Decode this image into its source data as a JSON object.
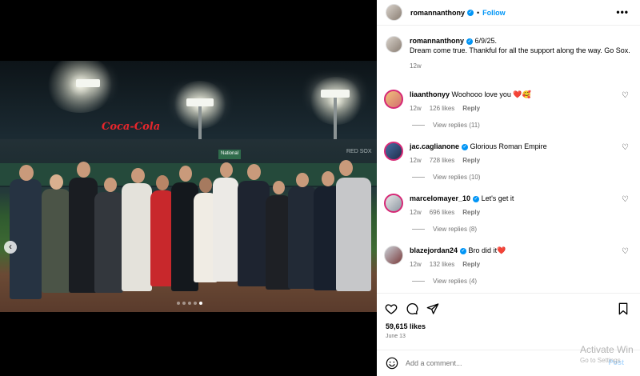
{
  "post": {
    "username": "romannanthony",
    "follow_label": "Follow",
    "more_label": "•••",
    "caption": {
      "username": "romannanthony",
      "date_prefix": "6/9/25.",
      "text": "Dream come true. Thankful for all the support along the way. Go Sox.",
      "time": "12w"
    },
    "likes": "59,615 likes",
    "date": "June 13"
  },
  "comments": [
    {
      "username": "liaanthonyy",
      "text": "Woohooo love you ❤️🥰",
      "verified": false,
      "time": "12w",
      "likes": "126 likes",
      "reply_label": "Reply",
      "view_replies": "View replies (11)"
    },
    {
      "username": "jac.caglianone",
      "text": "Glorious Roman Empire",
      "verified": true,
      "time": "12w",
      "likes": "728 likes",
      "reply_label": "Reply",
      "view_replies": "View replies (10)"
    },
    {
      "username": "marcelomayer_10",
      "text": "Let's get it",
      "verified": true,
      "time": "12w",
      "likes": "696 likes",
      "reply_label": "Reply",
      "view_replies": "View replies (8)"
    },
    {
      "username": "blazejordan24",
      "text": "Bro did it❤️",
      "verified": true,
      "time": "12w",
      "likes": "132 likes",
      "reply_label": "Reply",
      "view_replies": "View replies (4)"
    }
  ],
  "comment_box": {
    "placeholder": "Add a comment...",
    "post_label": "Post"
  },
  "photo": {
    "signs": [
      "Coca-Cola",
      "National",
      "RED SOX"
    ]
  },
  "carousel": {
    "total": 5,
    "active": 5
  },
  "watermark": {
    "line1": "Activate Win",
    "line2": "Go to Settings"
  },
  "icons": [
    "verified-icon",
    "heart-icon",
    "comment-icon",
    "share-icon",
    "bookmark-icon",
    "emoji-icon",
    "chevron-left-icon"
  ],
  "colors": {
    "accent": "#0095f6",
    "secondary_text": "#737373",
    "like_red": "#ed4956"
  }
}
